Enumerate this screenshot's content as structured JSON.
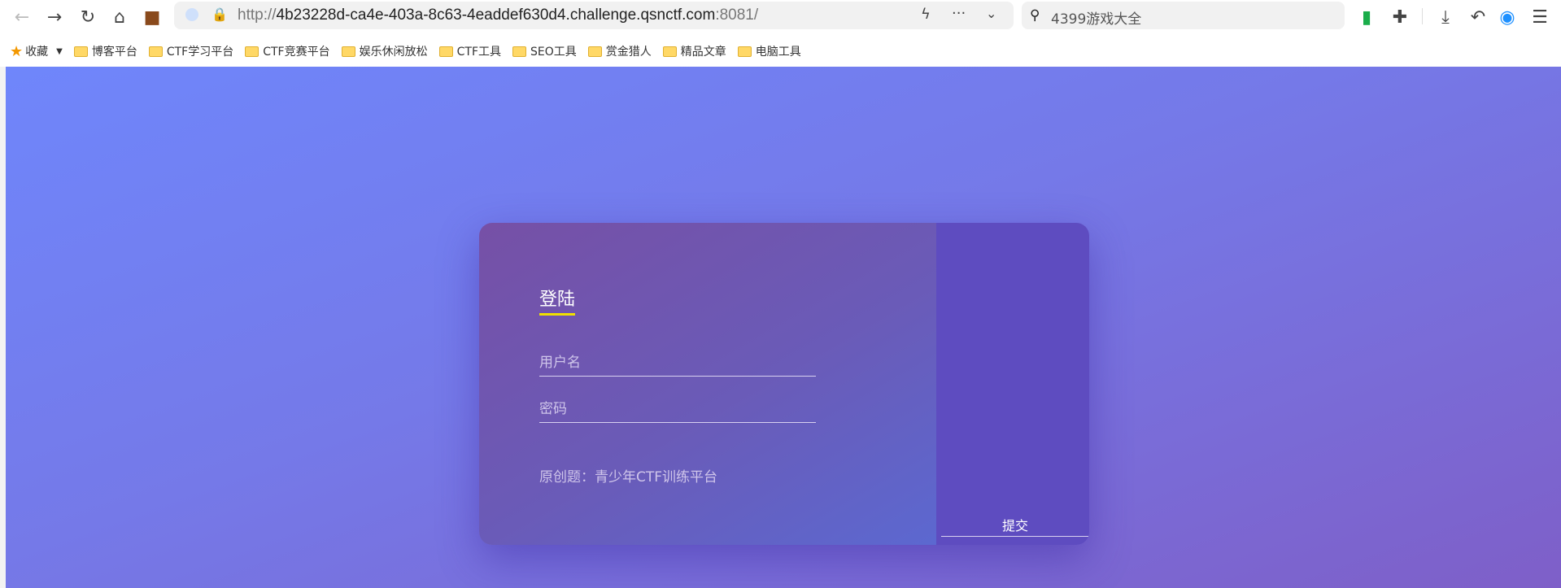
{
  "browser": {
    "url_prefix": "http://",
    "url_host": "4b23228d-ca4e-403a-8c63-4eaddef630d4.challenge.qsnctf.com",
    "url_port": ":8081/",
    "search_placeholder": "4399游戏大全",
    "bookmarks_label": "收藏",
    "bookmarks": [
      "博客平台",
      "CTF学习平台",
      "CTF竞赛平台",
      "娱乐休闲放松",
      "CTF工具",
      "SEO工具",
      "赏金猎人",
      "精品文章",
      "电脑工具"
    ]
  },
  "login": {
    "title": "登陆",
    "username_placeholder": "用户名",
    "password_placeholder": "密码",
    "note": "原创题：青少年CTF训练平台",
    "submit_label": "提交"
  },
  "colors": {
    "accent_underline": "#f0e000",
    "right_panel": "#5e4cc0"
  }
}
